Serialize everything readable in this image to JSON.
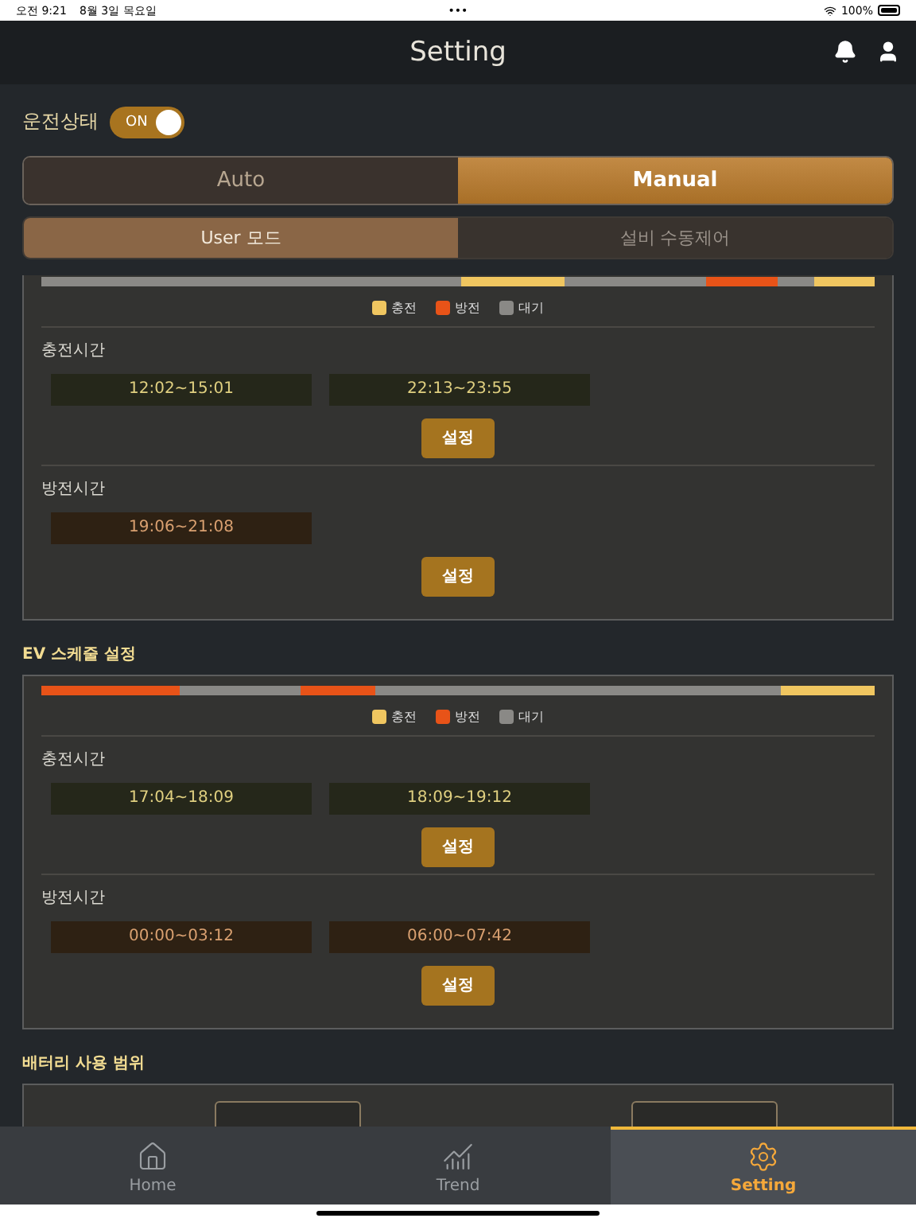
{
  "status_bar": {
    "time": "오전 9:21",
    "date": "8월 3일 목요일",
    "dots": "•••",
    "battery": "100%"
  },
  "header": {
    "title": "Setting"
  },
  "operation": {
    "label": "운전상태",
    "switch_text": "ON",
    "on": true
  },
  "mode_tabs": [
    {
      "label": "Auto",
      "selected": false
    },
    {
      "label": "Manual",
      "selected": true
    }
  ],
  "sub_tabs": [
    {
      "label": "User 모드",
      "selected": true
    },
    {
      "label": "설비 수동제어",
      "selected": false
    }
  ],
  "schedules": [
    {
      "segments": [
        {
          "kind": "idle"
        },
        {
          "kind": "charge"
        },
        {
          "kind": "idle"
        },
        {
          "kind": "discharge"
        },
        {
          "kind": "idle"
        },
        {
          "kind": "charge"
        }
      ],
      "legend": [
        {
          "kind": "charge",
          "label": "충전"
        },
        {
          "kind": "discharge",
          "label": "방전"
        },
        {
          "kind": "idle",
          "label": "대기"
        }
      ],
      "groups": [
        {
          "kind": "charge",
          "label": "충전시간",
          "times": [
            "12:02~15:01",
            "22:13~23:55"
          ],
          "button": "설정"
        },
        {
          "kind": "discharge",
          "label": "방전시간",
          "times": [
            "19:06~21:08"
          ],
          "button": "설정"
        }
      ]
    },
    {
      "title": "EV 스케줄 설정",
      "segments": [
        {
          "kind": "discharge"
        },
        {
          "kind": "idle"
        },
        {
          "kind": "discharge"
        },
        {
          "kind": "idle"
        },
        {
          "kind": "charge"
        },
        {
          "kind": "charge"
        }
      ],
      "legend": [
        {
          "kind": "charge",
          "label": "충전"
        },
        {
          "kind": "discharge",
          "label": "방전"
        },
        {
          "kind": "idle",
          "label": "대기"
        }
      ],
      "groups": [
        {
          "kind": "charge",
          "label": "충전시간",
          "times": [
            "17:04~18:09",
            "18:09~19:12"
          ],
          "button": "설정"
        },
        {
          "kind": "discharge",
          "label": "방전시간",
          "times": [
            "00:00~03:12",
            "06:00~07:42"
          ],
          "button": "설정"
        }
      ]
    }
  ],
  "battery_range": {
    "title": "배터리 사용 범위"
  },
  "tab_bar": [
    {
      "label": "Home",
      "selected": false
    },
    {
      "label": "Trend",
      "selected": false
    },
    {
      "label": "Setting",
      "selected": true
    }
  ]
}
